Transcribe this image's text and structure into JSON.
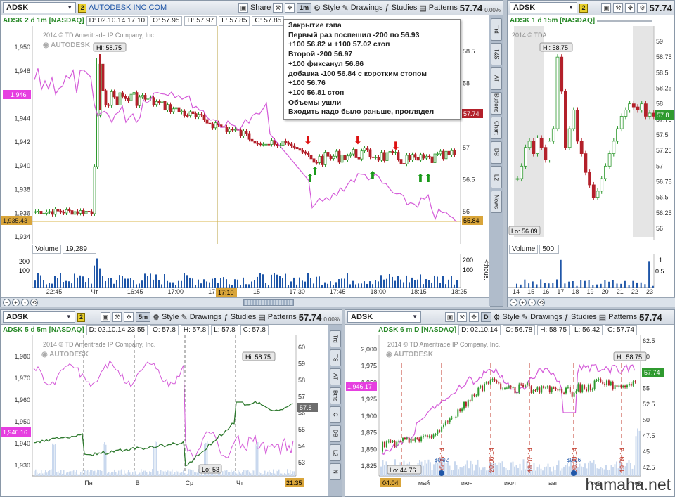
{
  "panels": {
    "p1": {
      "symbol": "ADSK",
      "link": "2",
      "company": "AUTODESK INC COM",
      "period": "1m",
      "price": "57.74",
      "pct": "0.00%",
      "study_name": "ADSK 2 d 1m [NASDAQ]",
      "fields": [
        "D: 02.10.14 17:10",
        "O: 57.95",
        "H: 57.97",
        "L: 57.85",
        "C: 57.85"
      ],
      "copyright": "2014 © TD Ameritrade IP Company, Inc.",
      "hi_label": "Hi: 58.75",
      "left_axis": [
        "1,950",
        "1,948",
        "1,946",
        "1,944",
        "1,942",
        "1,940",
        "1,938",
        "1,936",
        "1,934"
      ],
      "right_axis": [
        "58.5",
        "58",
        "57.5",
        "57",
        "56.5",
        "56"
      ],
      "tag_left_top": "1,946",
      "tag_left_bot": "1,935.43",
      "tag_right_top": "57.74",
      "tag_right_bot": "55.84",
      "volume_label": "Volume",
      "volume_value": "19,289",
      "vol_axis": [
        "200",
        "100"
      ],
      "vol_unit": "<thous.",
      "x_axis": [
        "22:45",
        "Чт",
        "16:45",
        "17:00",
        "17:10",
        "15",
        "17:30",
        "17:45",
        "18:00",
        "18:15",
        "18:25"
      ]
    },
    "p2": {
      "symbol": "ADSK",
      "link": "2",
      "price": "57.74",
      "study_name": "ADSK 1 d 15m [NASDAQ]",
      "copyright": "2014 © TDA",
      "hi_label": "Hi: 58.75",
      "lo_label": "Lo: 56.09",
      "right_axis": [
        "59",
        "58.75",
        "58.5",
        "58.25",
        "58",
        "57.75",
        "57.5",
        "57.25",
        "57",
        "56.75",
        "56.5",
        "56.25",
        "56"
      ],
      "tag": "57.8",
      "volume_label": "Volume",
      "volume_value": "500",
      "vol_axis": [
        "1",
        "0.5"
      ],
      "x_axis": [
        "14",
        "15",
        "16",
        "17",
        "18",
        "19",
        "20",
        "21",
        "22",
        "23"
      ]
    },
    "p3": {
      "symbol": "ADSK",
      "link": "2",
      "period": "5m",
      "price": "57.74",
      "pct": "0.00%",
      "study_name": "ADSK 5 d 5m [NASDAQ]",
      "fields": [
        "D: 02.10.14 23:55",
        "O: 57.8",
        "H: 57.8",
        "L: 57.8",
        "C: 57.8"
      ],
      "copyright": "2014 © TD Ameritrade IP Company, Inc.",
      "hi_label": "Hi: 58.75",
      "lo_label": "Lo: 53",
      "left_axis": [
        "1,980",
        "1,970",
        "1,960",
        "1,950",
        "1,940",
        "1,930"
      ],
      "right_axis": [
        "60",
        "59",
        "58",
        "57",
        "56",
        "55",
        "54",
        "53"
      ],
      "tag_left": "1,946.16",
      "tag_right": "57.8",
      "tag_time": "21:35",
      "x_axis": [
        "Пн",
        "Вт",
        "Ср",
        "Чт"
      ]
    },
    "p4": {
      "symbol": "ADSK",
      "period": "D",
      "price": "57.74",
      "study_name": "ADSK 6 m D [NASDAQ]",
      "fields": [
        "D: 02.10.14",
        "O: 56.78",
        "H: 58.75",
        "L: 56.42",
        "C: 57.74"
      ],
      "copyright": "2014 © TD Ameritrade IP Company, Inc.",
      "hi_label": "Hi: 58.75",
      "lo_label": "Lo: 44.76",
      "left_axis": [
        "2,000",
        "1,975",
        "1,950",
        "1,925",
        "1,900",
        "1,875",
        "1,850",
        "1,825"
      ],
      "right_axis": [
        "62.5",
        "60",
        "57.5",
        "55",
        "52.5",
        "50",
        "47.5",
        "45",
        "42.5"
      ],
      "tag_left": "1,946.17",
      "tag_right": "57.74",
      "tag_date": "04.04",
      "events": [
        "05.05.14",
        "20.06.14",
        "18.07.14",
        "08.08.14",
        "19.09.14"
      ],
      "event_vals": [
        "$0.02",
        "$0.26"
      ],
      "x_axis": [
        "май",
        "июн",
        "июл",
        "авг",
        "сен",
        "окт"
      ]
    }
  },
  "toolbar": {
    "share": "Share",
    "style": "Style",
    "drawings": "Drawings",
    "studies": "Studies",
    "patterns": "Patterns"
  },
  "sidebar_tabs": [
    "Trd",
    "T&S",
    "AT",
    "Buttons",
    "Chart",
    "DB",
    "L2",
    "News"
  ],
  "sidebar_tabs_small": [
    "Trd",
    "TS",
    "AT",
    "Btns",
    "C",
    "DB",
    "L2",
    "N"
  ],
  "note": [
    "Закрытие гэпа",
    "Первый раз поспешил -200 по 56.93",
    "+100 56.82 и +100 57.02 стоп",
    "Второй -200 56.97",
    "+100 фиксанул 56.86",
    "добавка -100 56.84 с коротким стопом",
    "+100 56.76",
    "+100 56.81 стоп",
    "Объемы ушли",
    "Входить надо было раньше, проглядел"
  ],
  "watermark": "hamaha.net",
  "colors": {
    "up": "#2f9a2f",
    "down": "#b3202a",
    "overlay": "#d45ad8",
    "accent": "#1f56a8",
    "sell_arrow": "#d11",
    "buy_arrow": "#1a9a1a"
  }
}
